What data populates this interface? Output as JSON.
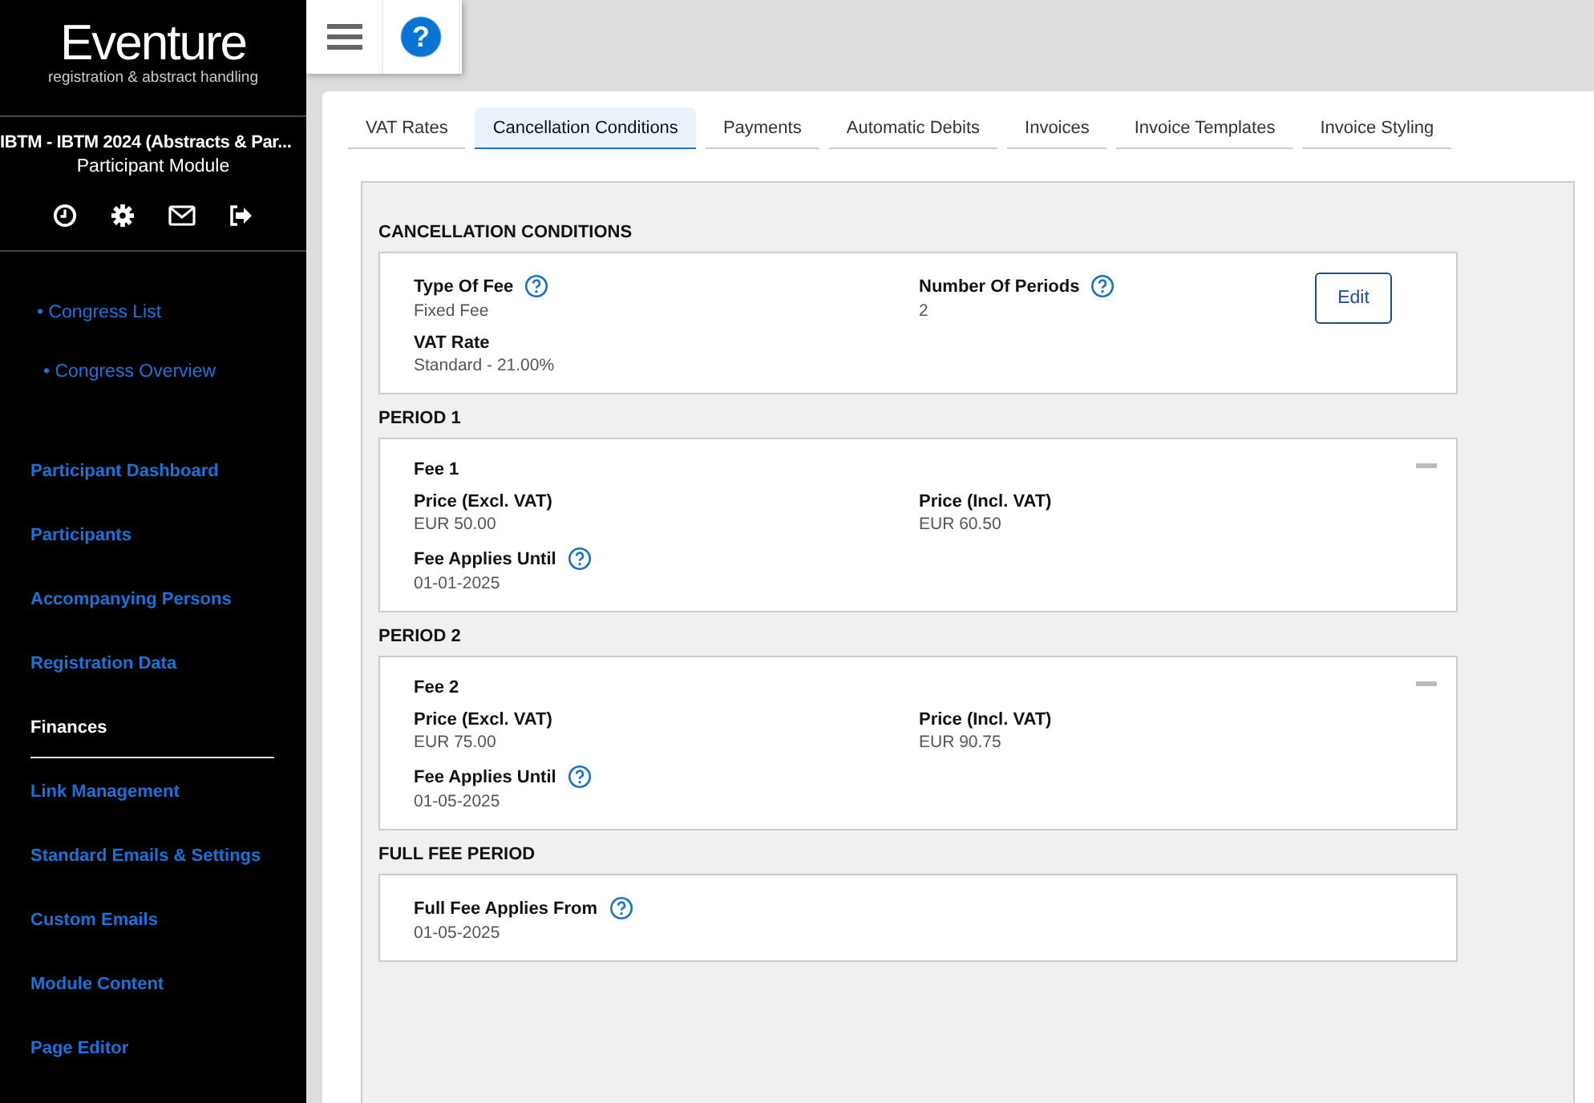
{
  "logo": {
    "name": "Eventure",
    "tagline": "registration & abstract handling"
  },
  "sidebar": {
    "event": "IBTM - IBTM 2024 (Abstracts & Par...",
    "module": "Participant Module",
    "sub_items": [
      {
        "label": "• Congress List"
      },
      {
        "label": "• Congress Overview"
      }
    ],
    "items": [
      {
        "label": "Participant Dashboard",
        "selected": false
      },
      {
        "label": "Participants",
        "selected": false
      },
      {
        "label": "Accompanying Persons",
        "selected": false
      },
      {
        "label": "Registration Data",
        "selected": false
      },
      {
        "label": "Finances",
        "selected": true
      },
      {
        "label": "Link Management",
        "selected": false
      },
      {
        "label": "Standard Emails & Settings",
        "selected": false
      },
      {
        "label": "Custom Emails",
        "selected": false
      },
      {
        "label": "Module Content",
        "selected": false
      },
      {
        "label": "Page Editor",
        "selected": false
      }
    ]
  },
  "toolbar": {
    "help": "?"
  },
  "tabs": [
    {
      "label": "VAT Rates",
      "selected": false
    },
    {
      "label": "Cancellation Conditions",
      "selected": true
    },
    {
      "label": "Payments",
      "selected": false
    },
    {
      "label": "Automatic Debits",
      "selected": false
    },
    {
      "label": "Invoices",
      "selected": false
    },
    {
      "label": "Invoice Templates",
      "selected": false
    },
    {
      "label": "Invoice Styling",
      "selected": false
    }
  ],
  "sections": [
    {
      "title": "CANCELLATION CONDITIONS",
      "edit_button": "Edit",
      "collapsible": false,
      "fields": [
        {
          "label": "Type Of Fee",
          "value": "Fixed Fee",
          "help": true
        },
        {
          "label": "Number Of Periods",
          "value": "2",
          "help": true
        },
        {
          "label": "VAT Rate",
          "value": "Standard - 21.00%",
          "help": false
        }
      ]
    },
    {
      "title": "PERIOD 1",
      "fee": "Fee 1",
      "collapsible": true,
      "fields": [
        {
          "label": "Price (Excl. VAT)",
          "value": "EUR 50.00",
          "help": false
        },
        {
          "label": "Price (Incl. VAT)",
          "value": "EUR 60.50",
          "help": false
        },
        {
          "label": "Fee Applies Until",
          "value": "01-01-2025",
          "help": true
        }
      ]
    },
    {
      "title": "PERIOD 2",
      "fee": "Fee 2",
      "collapsible": true,
      "fields": [
        {
          "label": "Price (Excl. VAT)",
          "value": "EUR 75.00",
          "help": false
        },
        {
          "label": "Price (Incl. VAT)",
          "value": "EUR 90.75",
          "help": false
        },
        {
          "label": "Fee Applies Until",
          "value": "01-05-2025",
          "help": true
        }
      ]
    },
    {
      "title": "FULL FEE PERIOD",
      "collapsible": false,
      "fields": [
        {
          "label": "Full Fee Applies From",
          "value": "01-05-2025",
          "help": true
        }
      ]
    }
  ]
}
